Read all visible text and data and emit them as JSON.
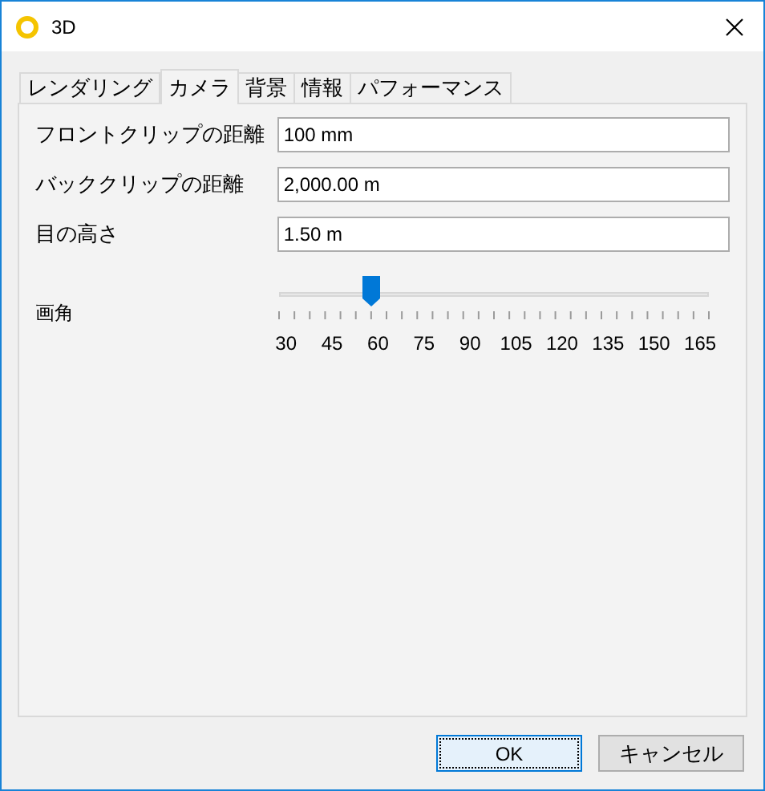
{
  "window": {
    "title": "3D"
  },
  "tabs": [
    {
      "label": "レンダリング",
      "selected": false
    },
    {
      "label": "カメラ",
      "selected": true
    },
    {
      "label": "背景",
      "selected": false
    },
    {
      "label": "情報",
      "selected": false
    },
    {
      "label": "パフォーマンス",
      "selected": false
    }
  ],
  "fields": [
    {
      "label": "フロントクリップの距離",
      "value": "100 mm"
    },
    {
      "label": "バッククリップの距離",
      "value": "2,000.00 m"
    },
    {
      "label": "目の高さ",
      "value": "1.50 m"
    }
  ],
  "slider": {
    "label": "画角",
    "level": 0.214,
    "tick_labels": [
      "30",
      "45",
      "60",
      "75",
      "90",
      "105",
      "120",
      "135",
      "150",
      "165"
    ]
  },
  "buttons": [
    {
      "label": "OK",
      "selected": true
    },
    {
      "label": "キャンセル",
      "selected": false
    }
  ]
}
